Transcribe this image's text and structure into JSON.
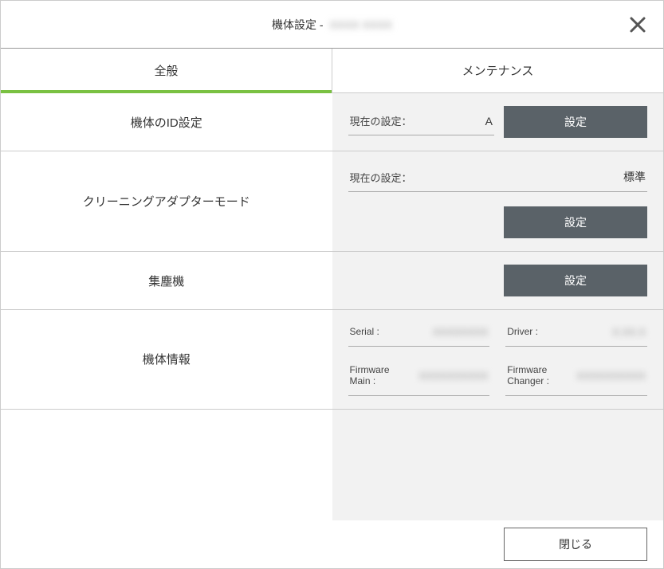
{
  "header": {
    "title_prefix": "機体設定 - ",
    "title_suffix_placeholder": "XXXX XXXX"
  },
  "tabs": {
    "general": "全般",
    "maintenance": "メンテナンス"
  },
  "rows": {
    "id": {
      "label": "機体のID設定",
      "current_label": "現在の設定：",
      "current_value": "A",
      "button": "設定"
    },
    "cleaning": {
      "label": "クリーニングアダプターモード",
      "current_label": "現在の設定：",
      "current_value": "標準",
      "button": "設定"
    },
    "dust": {
      "label": "集塵機",
      "button": "設定"
    },
    "info": {
      "label": "機体情報",
      "serial_label": "Serial :",
      "serial_value": "XXXXXXXX",
      "driver_label": "Driver :",
      "driver_value": "X.XX.X",
      "fw_main_label": "Firmware Main :",
      "fw_main_value": "XXXXXXXXXX",
      "fw_changer_label": "Firmware Changer :",
      "fw_changer_value": "XXXXXXXXXX"
    }
  },
  "footer": {
    "close": "閉じる"
  }
}
